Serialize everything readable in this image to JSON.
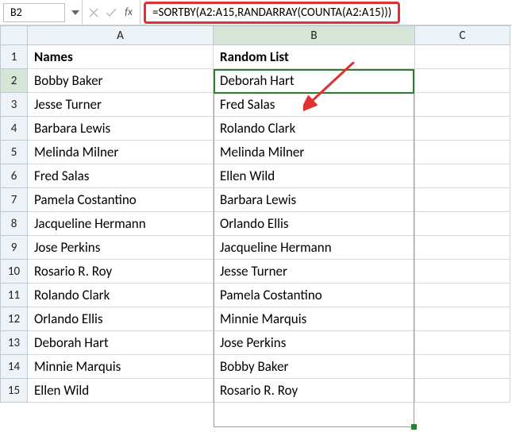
{
  "name_box": "B2",
  "formula": "=SORTBY(A2:A15,RANDARRAY(COUNTA(A2:A15)))",
  "columns": [
    "A",
    "B",
    "C"
  ],
  "headers": {
    "A": "Names",
    "B": "Random List"
  },
  "rows": [
    {
      "n": 1,
      "A": "Names",
      "B": "Random List",
      "bold": true
    },
    {
      "n": 2,
      "A": "Bobby Baker",
      "B": "Deborah Hart"
    },
    {
      "n": 3,
      "A": "Jesse Turner",
      "B": "Fred Salas"
    },
    {
      "n": 4,
      "A": "Barbara Lewis",
      "B": "Rolando Clark"
    },
    {
      "n": 5,
      "A": "Melinda Milner",
      "B": "Melinda Milner"
    },
    {
      "n": 6,
      "A": "Fred Salas",
      "B": "Ellen Wild"
    },
    {
      "n": 7,
      "A": "Pamela Costantino",
      "B": "Barbara Lewis"
    },
    {
      "n": 8,
      "A": "Jacqueline Hermann",
      "B": "Orlando Ellis"
    },
    {
      "n": 9,
      "A": "Jose Perkins",
      "B": "Jacqueline Hermann"
    },
    {
      "n": 10,
      "A": "Rosario R. Roy",
      "B": "Jesse Turner"
    },
    {
      "n": 11,
      "A": "Rolando Clark",
      "B": "Pamela Costantino"
    },
    {
      "n": 12,
      "A": "Orlando Ellis",
      "B": "Minnie Marquis"
    },
    {
      "n": 13,
      "A": "Deborah Hart",
      "B": "Jose Perkins"
    },
    {
      "n": 14,
      "A": "Minnie Marquis",
      "B": "Bobby Baker"
    },
    {
      "n": 15,
      "A": "Ellen Wild",
      "B": "Rosario R. Roy"
    }
  ],
  "active_cell": "B2",
  "fx_label": "fx"
}
